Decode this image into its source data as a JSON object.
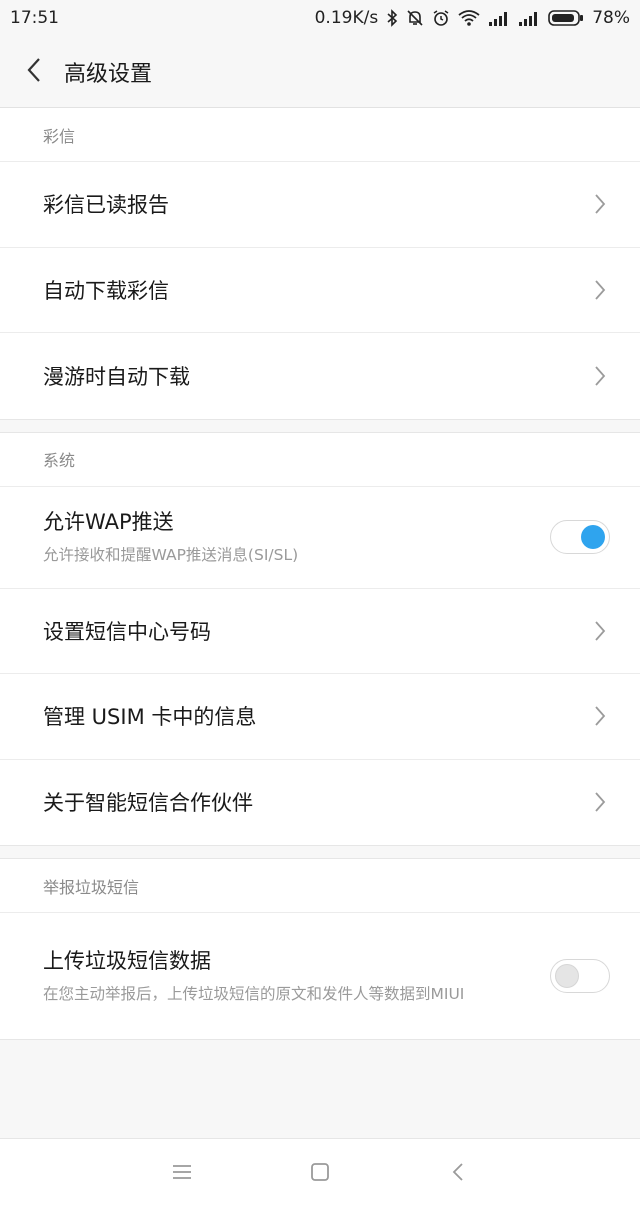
{
  "status_bar": {
    "time": "17:51",
    "net_speed": "0.19K/s",
    "battery": "78%",
    "icons": [
      "bluetooth-icon",
      "mute-bell-icon",
      "alarm-icon",
      "wifi-icon",
      "signal-icon",
      "signal-icon",
      "battery-icon"
    ]
  },
  "header": {
    "back_icon": "back-arrow-icon",
    "title": "高级设置"
  },
  "sections": [
    {
      "header": "彩信",
      "rows": [
        {
          "title": "彩信已读报告",
          "type": "link"
        },
        {
          "title": "自动下载彩信",
          "type": "link"
        },
        {
          "title": "漫游时自动下载",
          "type": "link"
        }
      ]
    },
    {
      "header": "系统",
      "rows": [
        {
          "title": "允许WAP推送",
          "subtitle": "允许接收和提醒WAP推送消息(SI/SL)",
          "type": "toggle",
          "enabled": true
        },
        {
          "title": "设置短信中心号码",
          "type": "link"
        },
        {
          "title": "管理 USIM 卡中的信息",
          "type": "link"
        },
        {
          "title": "关于智能短信合作伙伴",
          "type": "link"
        }
      ]
    },
    {
      "header": "举报垃圾短信",
      "rows": [
        {
          "title": "上传垃圾短信数据",
          "subtitle": "在您主动举报后，上传垃圾短信的原文和发件人等数据到MIUI",
          "type": "toggle",
          "enabled": false
        }
      ]
    }
  ],
  "nav_bar": {
    "icons": [
      "menu-icon",
      "home-icon",
      "back-icon"
    ]
  },
  "colors": {
    "accent": "#2fa4ee",
    "background": "#f7f7f7",
    "card": "#ffffff"
  }
}
